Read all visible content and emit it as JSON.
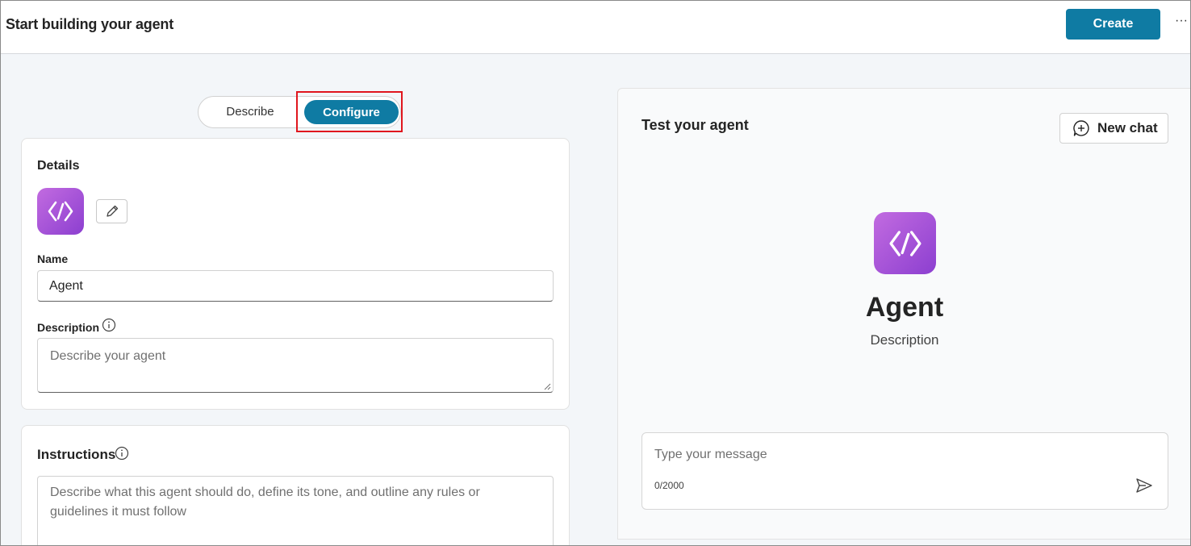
{
  "header": {
    "title": "Start building your agent",
    "create_label": "Create",
    "more_label": "···"
  },
  "mode_toggle": {
    "describe_label": "Describe",
    "configure_label": "Configure",
    "selected": "Configure"
  },
  "details": {
    "section_title": "Details",
    "icon": "agent-code-icon",
    "edit_icon": "pencil-icon",
    "name_label": "Name",
    "name_value": "Agent",
    "description_label": "Description",
    "description_placeholder": "Describe your agent"
  },
  "instructions": {
    "section_title": "Instructions",
    "placeholder": "Describe what this agent should do, define its tone, and outline any rules or guidelines it must follow"
  },
  "test_panel": {
    "title": "Test your agent",
    "new_chat_label": "New chat",
    "agent_name": "Agent",
    "agent_description": "Description",
    "message_placeholder": "Type your message",
    "char_count": "0/2000"
  },
  "colors": {
    "accent": "#0f7ba3",
    "highlight": "#e0161e",
    "icon_gradient_start": "#c26be0",
    "icon_gradient_end": "#8c3fd0"
  }
}
